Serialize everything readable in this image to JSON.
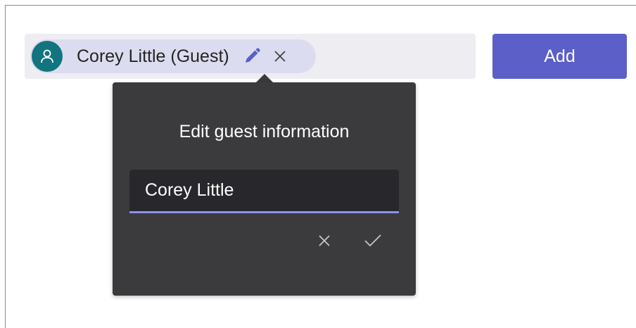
{
  "people_field": {
    "pill": {
      "name": "Corey Little (Guest)",
      "avatar_icon": "person-icon",
      "edit_icon": "pencil-icon",
      "remove_icon": "close-icon",
      "avatar_color": "#12747f",
      "pill_color": "#dcdcf0"
    },
    "field_color": "#ededf2"
  },
  "add_button": {
    "label": "Add",
    "color": "#5b5fc7"
  },
  "edit_popover": {
    "title": "Edit guest information",
    "name_value": "Corey Little",
    "cancel_icon": "close-icon",
    "confirm_icon": "checkmark-icon",
    "background_color": "#3b3a3d",
    "input_underline_color": "#8e90f0"
  }
}
